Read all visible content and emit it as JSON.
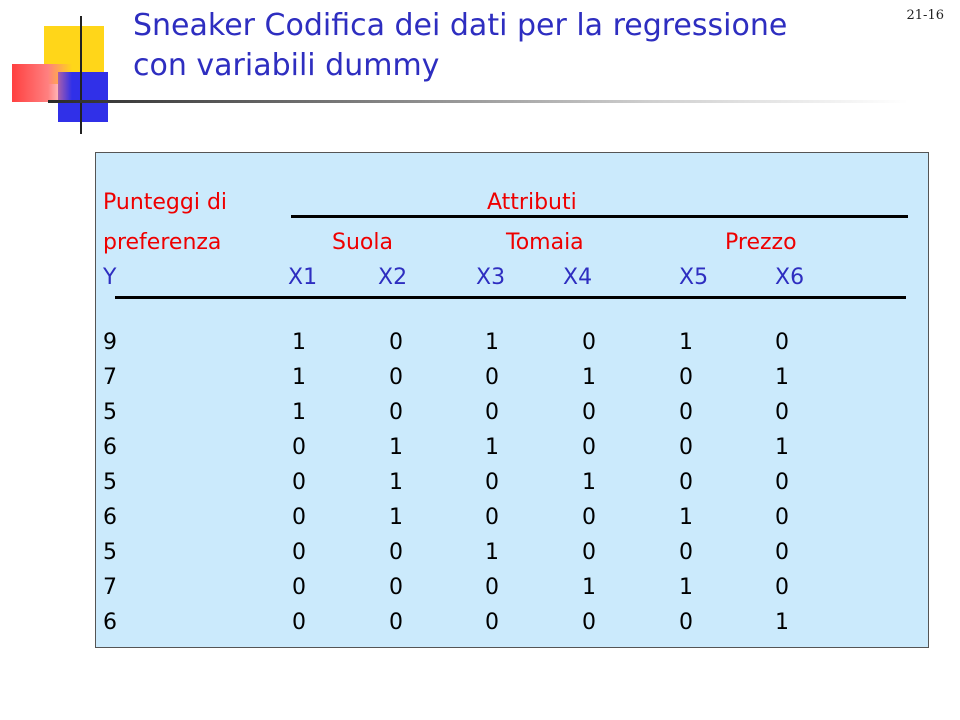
{
  "page_number": "21-16",
  "title_line1": "Sneaker Codifica dei dati per la regressione",
  "title_line2": "con variabili dummy",
  "header": {
    "punteggi": "Punteggi di",
    "preferenza": "preferenza",
    "attributi": "Attributi",
    "suola": "Suola",
    "tomaia": "Tomaia",
    "prezzo": "Prezzo"
  },
  "columns": [
    "Y",
    "X1",
    "X2",
    "X3",
    "X4",
    "X5",
    "X6"
  ],
  "rows": [
    [
      "9",
      "1",
      "0",
      "1",
      "0",
      "1",
      "0"
    ],
    [
      "7",
      "1",
      "0",
      "0",
      "1",
      "0",
      "1"
    ],
    [
      "5",
      "1",
      "0",
      "0",
      "0",
      "0",
      "0"
    ],
    [
      "6",
      "0",
      "1",
      "1",
      "0",
      "0",
      "1"
    ],
    [
      "5",
      "0",
      "1",
      "0",
      "1",
      "0",
      "0"
    ],
    [
      "6",
      "0",
      "1",
      "0",
      "0",
      "1",
      "0"
    ],
    [
      "5",
      "0",
      "0",
      "1",
      "0",
      "0",
      "0"
    ],
    [
      "7",
      "0",
      "0",
      "0",
      "1",
      "1",
      "0"
    ],
    [
      "6",
      "0",
      "0",
      "0",
      "0",
      "0",
      "1"
    ]
  ]
}
